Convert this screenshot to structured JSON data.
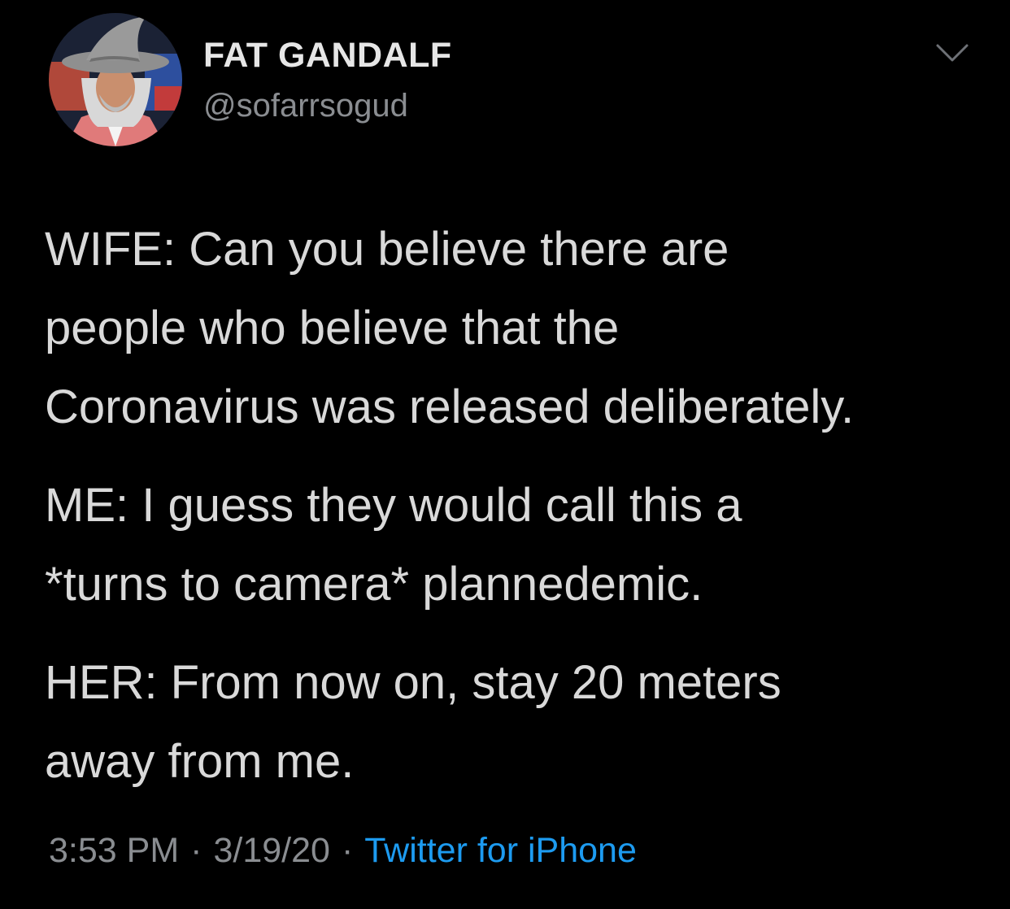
{
  "author": {
    "display_name": "FAT GANDALF",
    "handle": "@sofarrsogud"
  },
  "tweet": {
    "paragraphs": [
      [
        "WIFE: Can you believe there are",
        "people who believe that the",
        "Coronavirus was released deliberately."
      ],
      [
        "ME: I guess they would call this a",
        "*turns to camera* plannedemic."
      ],
      [
        "HER: From now on, stay 20 meters",
        "away from me."
      ]
    ],
    "time": "3:53 PM",
    "date": "3/19/20",
    "separator": "·",
    "source": "Twitter for iPhone"
  },
  "icons": {
    "avatar": "profile-photo-wizard-hat",
    "menu": "chevron-down-icon"
  },
  "colors": {
    "background": "#000000",
    "text": "#d9d9d9",
    "secondary": "#8a8d91",
    "link": "#1d9bf0"
  }
}
